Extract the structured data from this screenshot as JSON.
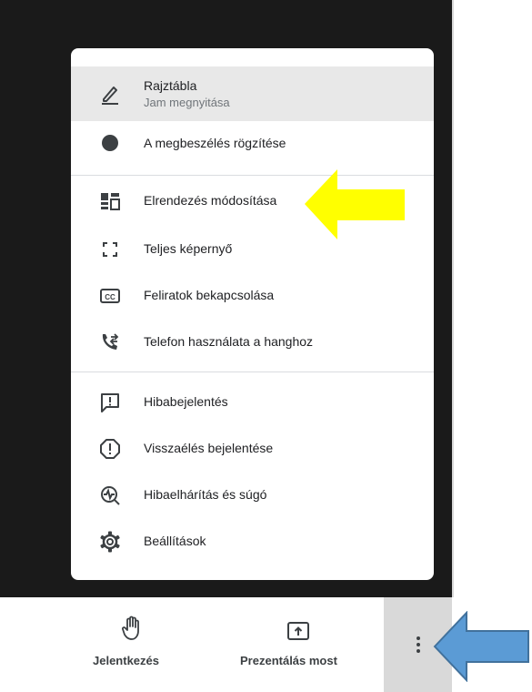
{
  "menu": {
    "items": [
      {
        "label": "Rajztábla",
        "sublabel": "Jam megnyitása",
        "icon": "pencil-icon"
      },
      {
        "label": "A megbeszélés rögzítése",
        "icon": "record-icon"
      },
      {
        "label": "Elrendezés módosítása",
        "icon": "layout-icon"
      },
      {
        "label": "Teljes képernyő",
        "icon": "fullscreen-icon"
      },
      {
        "label": "Feliratok bekapcsolása",
        "icon": "captions-icon"
      },
      {
        "label": "Telefon használata a hanghoz",
        "icon": "phone-icon"
      },
      {
        "label": "Hibabejelentés",
        "icon": "feedback-icon"
      },
      {
        "label": "Visszaélés bejelentése",
        "icon": "report-icon"
      },
      {
        "label": "Hibaelhárítás és súgó",
        "icon": "troubleshoot-icon"
      },
      {
        "label": "Beállítások",
        "icon": "gear-icon"
      }
    ]
  },
  "bottombar": {
    "raise_hand_label": "Jelentkezés",
    "present_label": "Prezentálás most"
  },
  "colors": {
    "yellow_arrow": "#ffff00",
    "blue_arrow": "#5b9bd5",
    "blue_arrow_border": "#41719c",
    "icon": "#3c4043"
  }
}
